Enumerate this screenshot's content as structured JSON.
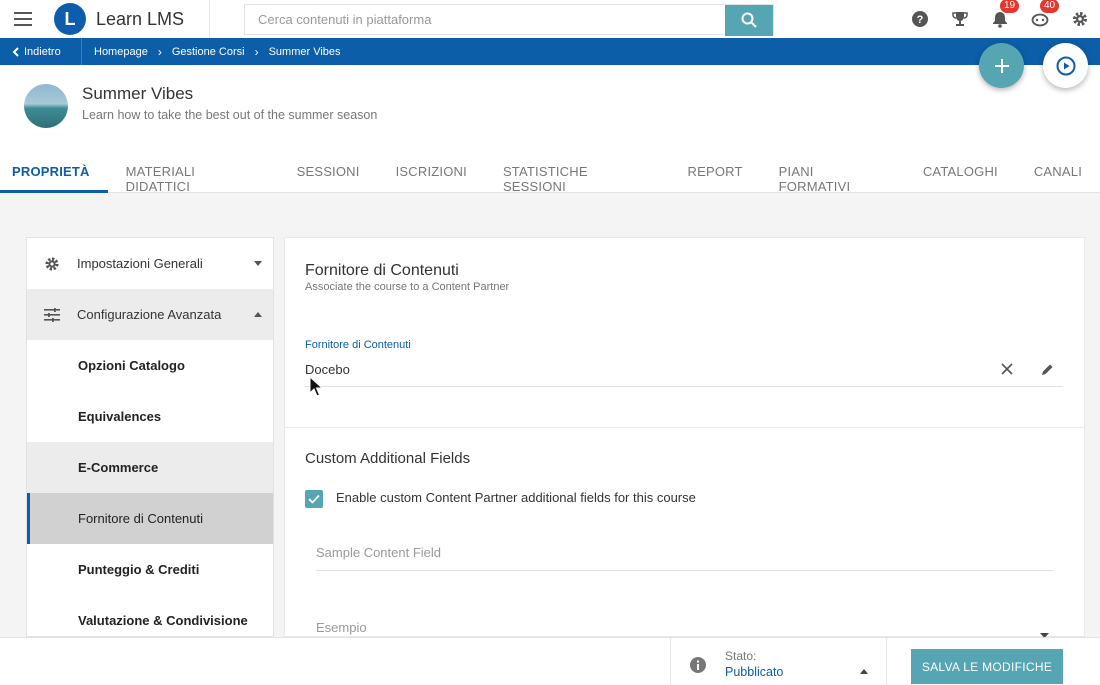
{
  "app": {
    "brand_name": "Learn LMS",
    "brand_letter": "L"
  },
  "search": {
    "placeholder": "Cerca contenuti in piattaforma"
  },
  "top_icons": {
    "help": "help-icon",
    "trophy": "trophy-icon",
    "notifications": "bell-icon",
    "notifications_count": "19",
    "messages": "chat-icon",
    "messages_count": "40",
    "settings": "gear-icon"
  },
  "breadcrumb": {
    "back_label": "Indietro",
    "items": [
      "Homepage",
      "Gestione Corsi",
      "Summer Vibes"
    ]
  },
  "course": {
    "title": "Summer Vibes",
    "subtitle": "Learn how to take the best out of the summer season"
  },
  "tabs": [
    {
      "label": "PROPRIETÀ",
      "active": true
    },
    {
      "label": "MATERIALI DIDATTICI"
    },
    {
      "label": "SESSIONI"
    },
    {
      "label": "ISCRIZIONI"
    },
    {
      "label": "STATISTICHE SESSIONI"
    },
    {
      "label": "REPORT"
    },
    {
      "label": "PIANI FORMATIVI"
    },
    {
      "label": "CATALOGHI"
    },
    {
      "label": "CANALI"
    }
  ],
  "menu": {
    "general": "Impostazioni Generali",
    "advanced": "Configurazione Avanzata",
    "items": [
      "Opzioni Catalogo",
      "Equivalences",
      "E-Commerce",
      "Fornitore di Contenuti",
      "Punteggio & Crediti",
      "Valutazione & Condivisione"
    ]
  },
  "content": {
    "section_title": "Fornitore di Contenuti",
    "section_subtitle": "Associate the course to a Content Partner",
    "field_label": "Fornitore di Contenuti",
    "field_value": "Docebo",
    "custom_title": "Custom Additional Fields",
    "checkbox_label": "Enable custom Content Partner additional fields for this course",
    "checkbox_checked": true,
    "sample_placeholder": "Sample Content Field",
    "example_placeholder": "Esempio"
  },
  "footer": {
    "status_label": "Stato:",
    "status_value": "Pubblicato",
    "save_label": "SALVA LE MODIFICHE"
  },
  "colors": {
    "brand_blue": "#0c5ea8",
    "accent_teal": "#56a5b3",
    "badge_red": "#e3382f"
  }
}
